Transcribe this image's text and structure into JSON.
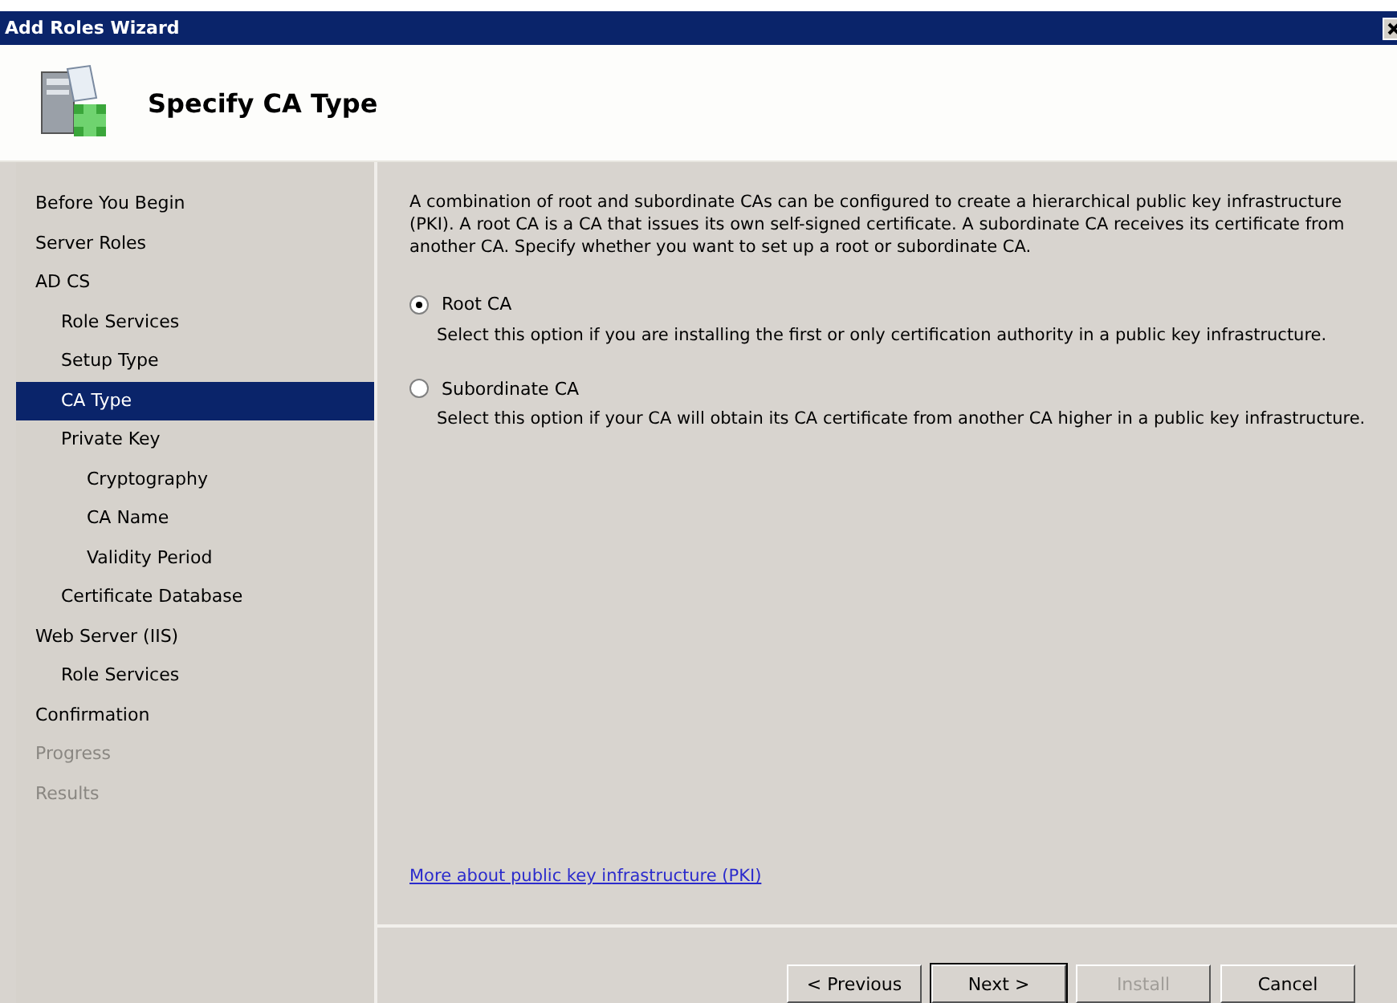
{
  "window": {
    "title": "Add Roles Wizard"
  },
  "header": {
    "title": "Specify CA Type"
  },
  "sidebar": {
    "items": [
      {
        "label": "Before You Begin",
        "selected": false,
        "disabled": false
      },
      {
        "label": "Server Roles",
        "selected": false,
        "disabled": false
      },
      {
        "label": "AD CS",
        "selected": false,
        "disabled": false,
        "children": [
          {
            "label": "Role Services",
            "selected": false,
            "disabled": false
          },
          {
            "label": "Setup Type",
            "selected": false,
            "disabled": false
          },
          {
            "label": "CA Type",
            "selected": true,
            "disabled": false
          },
          {
            "label": "Private Key",
            "selected": false,
            "disabled": false,
            "children": [
              {
                "label": "Cryptography",
                "selected": false,
                "disabled": false
              },
              {
                "label": "CA Name",
                "selected": false,
                "disabled": false
              },
              {
                "label": "Validity Period",
                "selected": false,
                "disabled": false
              }
            ]
          },
          {
            "label": "Certificate Database",
            "selected": false,
            "disabled": false
          }
        ]
      },
      {
        "label": "Web Server (IIS)",
        "selected": false,
        "disabled": false,
        "children": [
          {
            "label": "Role Services",
            "selected": false,
            "disabled": false
          }
        ]
      },
      {
        "label": "Confirmation",
        "selected": false,
        "disabled": false
      },
      {
        "label": "Progress",
        "selected": false,
        "disabled": true
      },
      {
        "label": "Results",
        "selected": false,
        "disabled": true
      }
    ]
  },
  "content": {
    "intro": "A combination of root and subordinate CAs can be configured to create a hierarchical public key infrastructure (PKI). A root CA is a CA that issues its own self-signed certificate. A subordinate CA receives its certificate from another CA. Specify whether you want to set up a root or subordinate CA.",
    "options": [
      {
        "label": "Root CA",
        "description": "Select this option if you are installing the first or only certification authority in a public key infrastructure.",
        "selected": true
      },
      {
        "label": "Subordinate CA",
        "description": "Select this option if your CA will obtain its CA certificate from another CA higher in a public key infrastructure.",
        "selected": false
      }
    ],
    "link": "More about public key infrastructure (PKI)"
  },
  "buttons": [
    {
      "label": "< Previous",
      "disabled": false,
      "default": false
    },
    {
      "label": "Next >",
      "disabled": false,
      "default": true
    },
    {
      "label": "Install",
      "disabled": true,
      "default": false
    },
    {
      "label": "Cancel",
      "disabled": false,
      "default": false
    }
  ]
}
